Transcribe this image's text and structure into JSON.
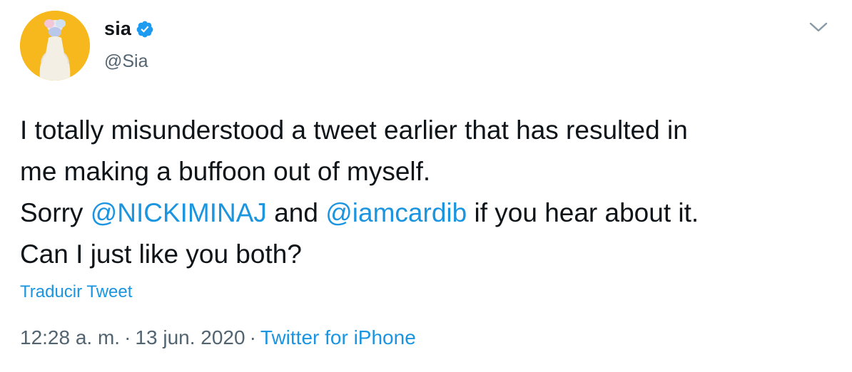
{
  "author": {
    "display_name": "sia",
    "handle": "@Sia",
    "verified_icon": "verified-badge-icon"
  },
  "menu": {
    "caret_icon": "chevron-down-icon"
  },
  "tweet": {
    "line1": "I totally misunderstood a tweet earlier that has resulted in",
    "line2": "me making a buffoon out of myself.",
    "line3_pre": "Sorry ",
    "mention1": "@NICKIMINAJ",
    "line3_mid": " and ",
    "mention2": "@iamcardib",
    "line3_post": " if you hear about it.",
    "line4": "Can I just like you both?"
  },
  "translate_label": "Traducir Tweet",
  "meta": {
    "time": "12:28 a. m.",
    "separator": "·",
    "date": "13 jun. 2020",
    "source": "Twitter for iPhone"
  },
  "colors": {
    "link": "#1b95e0",
    "muted": "#536471",
    "avatar_bg": "#f6b81c"
  }
}
